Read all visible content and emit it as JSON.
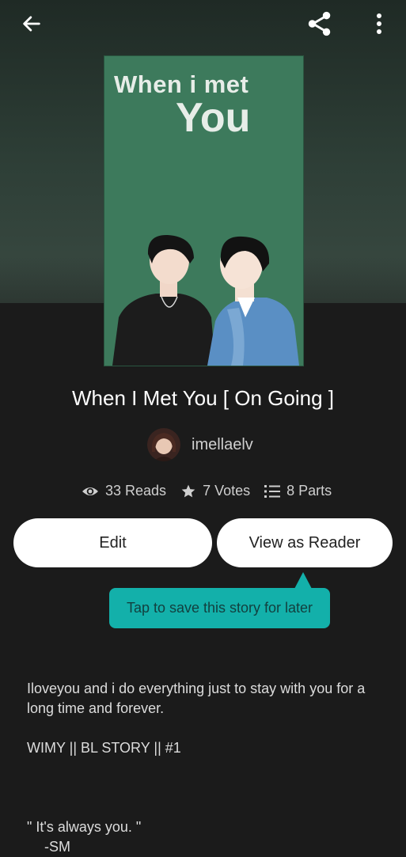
{
  "cover": {
    "title_line1": "When i met",
    "title_line2": "You"
  },
  "story": {
    "title": "When I Met You [ On Going ]",
    "author": "imellaelv"
  },
  "stats": {
    "reads": "33 Reads",
    "votes": "7 Votes",
    "parts": "8 Parts"
  },
  "actions": {
    "edit_label": "Edit",
    "view_reader_label": "View as Reader"
  },
  "tooltip": {
    "text": "Tap to save this story for later"
  },
  "description": {
    "line1": "Iloveyou and i do everything just to stay with you for a long time and forever.",
    "line2": "WIMY || BL STORY || #1",
    "line3": "\" It's always you. \"",
    "line4": "-SM"
  },
  "icons": {
    "back": "arrow-left-icon",
    "share": "share-icon",
    "more": "more-vertical-icon",
    "reads": "eye-icon",
    "votes": "star-icon",
    "parts": "list-icon"
  },
  "colors": {
    "background": "#1b1b1b",
    "tooltip": "#13b0aa",
    "cover_green": "#3d7a5c"
  }
}
